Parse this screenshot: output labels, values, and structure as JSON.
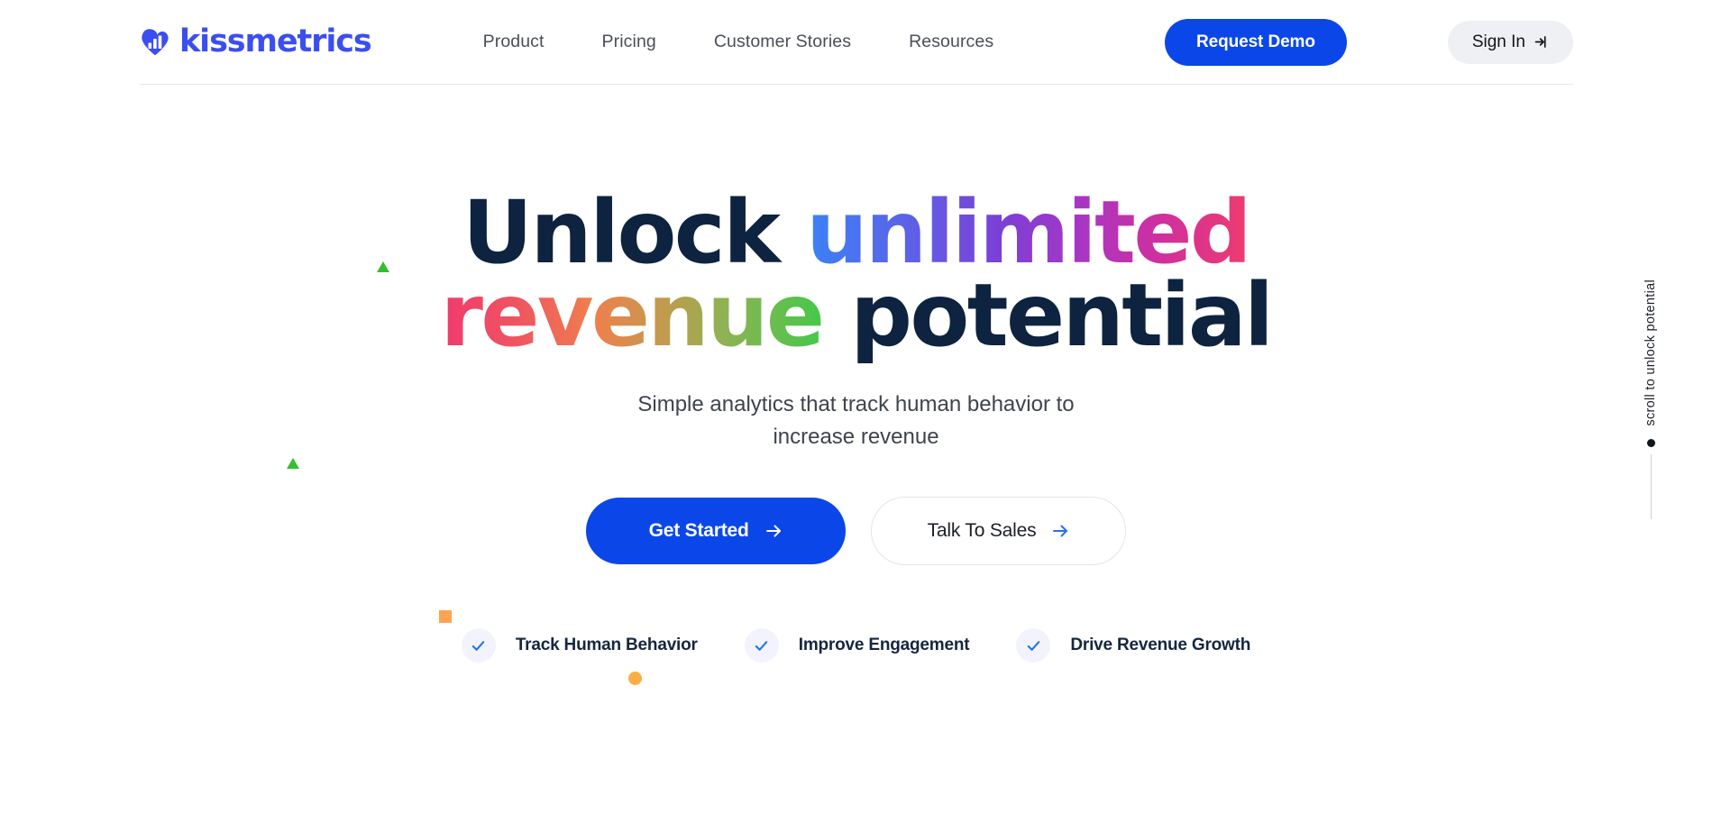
{
  "brand": {
    "name": "kissmetrics",
    "logo_icon": "cloud-bar-chart-icon",
    "accent_blue": "#3b4ef0",
    "cta_blue": "#0b47e8"
  },
  "header": {
    "nav": [
      {
        "label": "Product"
      },
      {
        "label": "Pricing"
      },
      {
        "label": "Customer Stories"
      },
      {
        "label": "Resources"
      }
    ],
    "request_demo_label": "Request Demo",
    "sign_in_label": "Sign In",
    "sign_in_icon": "login-arrow-icon"
  },
  "hero": {
    "headline": {
      "line1_part1": "Unlock ",
      "line1_part2": "unlimited",
      "line2_part1": "revenue",
      "line2_part2": " potential"
    },
    "subhead": "Simple analytics that track human behavior to increase revenue",
    "primary_cta": {
      "label": "Get Started",
      "icon": "arrow-right-icon"
    },
    "secondary_cta": {
      "label": "Talk To Sales",
      "icon": "arrow-right-icon"
    },
    "features": [
      {
        "label": "Track Human Behavior",
        "icon": "check-icon"
      },
      {
        "label": "Improve Engagement",
        "icon": "check-icon"
      },
      {
        "label": "Drive Revenue Growth",
        "icon": "check-icon"
      }
    ]
  },
  "scroll_indicator": {
    "text": "scroll to unlock potential"
  },
  "decorations": {
    "triangle_color": "#34bf2e",
    "square_color": "#ffa352",
    "dot_color": "#fbae45"
  },
  "gradients": {
    "unlimited": [
      "#3b82f6",
      "#7c3fd6",
      "#ef3b6e"
    ],
    "revenue": [
      "#f03a6e",
      "#ef7f4e",
      "#45c84a"
    ],
    "dark_text": "#0d2340"
  }
}
